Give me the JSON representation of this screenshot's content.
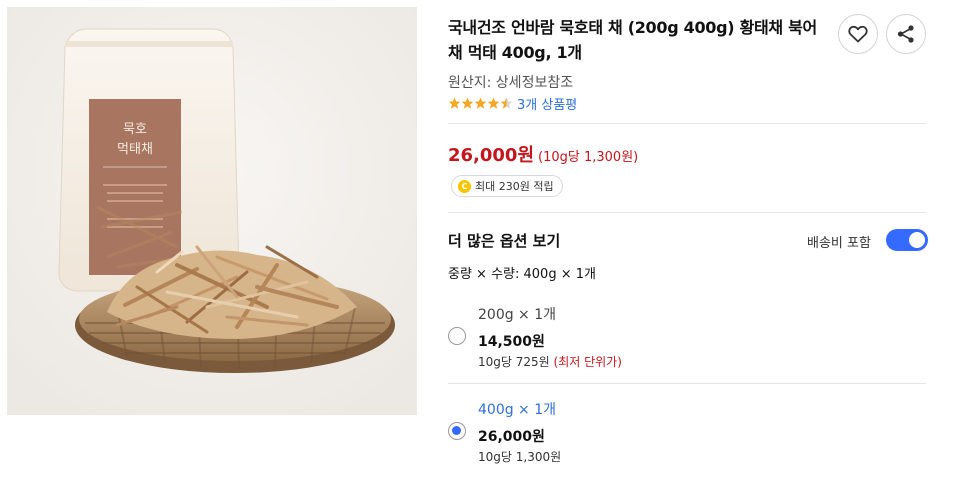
{
  "product": {
    "title": "국내건조 언바람 묵호태 채 (200g 400g) 황태채 북어채 먹태 400g, 1개",
    "origin": "원산지: 상세정보참조",
    "rating": 4.5,
    "review_text": "3개 상품평",
    "price": "26,000원",
    "unit_price": "(10g당 1,300원)",
    "points_text": "최대 230원 적립",
    "coin_symbol": "C"
  },
  "options_section": {
    "title": "더 많은 옵션 보기",
    "shipping_label": "배송비 포함",
    "shipping_included": true,
    "summary": "중량 × 수량: 400g × 1개"
  },
  "options": [
    {
      "name": "200g × 1개",
      "price": "14,500원",
      "unit": "10g당 725원",
      "badge": "(최저 단위가)",
      "selected": false
    },
    {
      "name": "400g × 1개",
      "price": "26,000원",
      "unit": "10g당 1,300원",
      "badge": "",
      "selected": true
    }
  ],
  "package_label": {
    "line1": "묵호",
    "line2": "먹태채"
  },
  "colors": {
    "price_red": "#c4161c",
    "link_blue": "#2f6fd7",
    "toggle_blue": "#346aff",
    "star": "#f5a623",
    "label_brown": "#a87561"
  },
  "icons": {
    "like": "heart-icon",
    "share": "share-icon",
    "points": "coin-icon"
  }
}
